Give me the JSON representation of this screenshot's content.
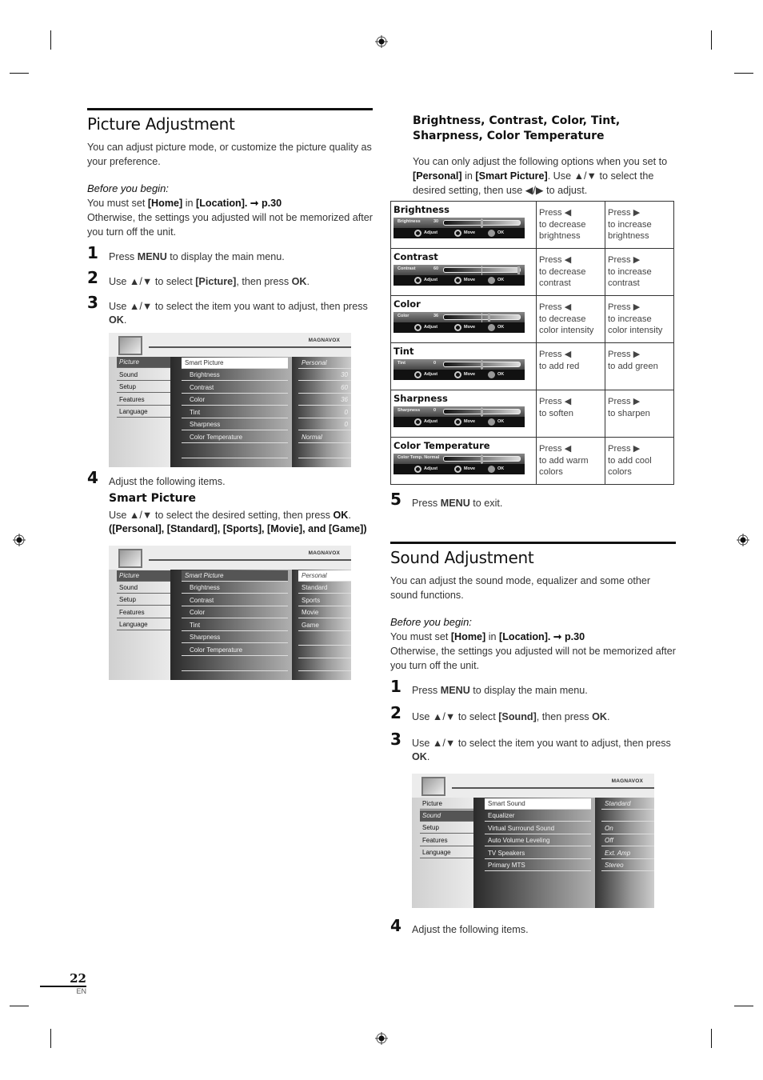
{
  "picture_adjustment": {
    "title": "Picture Adjustment",
    "intro": "You can adjust picture mode, or customize the picture quality as your preference.",
    "before_label": "Before you begin:",
    "before_line1_pre": "You must set ",
    "before_line1_home": "[Home]",
    "before_line1_in": " in ",
    "before_line1_loc": "[Location]",
    "before_line1_ref": ". ➞ p.30",
    "before_line2": "Otherwise, the settings you adjusted will not be memorized after you turn off the unit.",
    "steps": [
      {
        "num": "1",
        "pre": "Press ",
        "key": "MENU",
        "post": " to display the main menu."
      },
      {
        "num": "2",
        "pre": "Use ▲/▼ to select ",
        "key": "[Picture]",
        "post": ", then press ",
        "key2": "OK",
        "post2": "."
      },
      {
        "num": "3",
        "pre": "Use ▲/▼ to select the item you want to adjust, then press ",
        "key": "OK",
        "post": "."
      },
      {
        "num": "4",
        "text": "Adjust the following items."
      }
    ],
    "smart_picture": {
      "heading": "Smart Picture",
      "line1_pre": "Use ▲/▼ to select the desired setting, then press ",
      "line1_key": "OK",
      "line1_post": ".",
      "options_text": "([Personal], [Standard], [Sports], [Movie], and [Game])"
    }
  },
  "tv_menu_1": {
    "brand": "MAGNAVOX",
    "left_items": [
      "Picture",
      "Sound",
      "Setup",
      "Features",
      "Language"
    ],
    "selected_left": "Picture",
    "mid_items": [
      "Smart Picture",
      "Brightness",
      "Contrast",
      "Color",
      "Tint",
      "Sharpness",
      "Color Temperature"
    ],
    "right_values": [
      "Personal",
      "30",
      "60",
      "36",
      "0",
      "0",
      "Normal"
    ]
  },
  "tv_menu_2": {
    "brand": "MAGNAVOX",
    "left_items": [
      "Picture",
      "Sound",
      "Setup",
      "Features",
      "Language"
    ],
    "mid_items": [
      "Smart Picture",
      "Brightness",
      "Contrast",
      "Color",
      "Tint",
      "Sharpness",
      "Color Temperature"
    ],
    "right_options": [
      "Personal",
      "Standard",
      "Sports",
      "Movie",
      "Game"
    ],
    "selected_option": "Personal"
  },
  "adjust_section": {
    "heading": "Brightness, Contrast, Color, Tint, Sharpness, Color Temperature",
    "intro_pre": "You can only adjust the following options when you set to ",
    "intro_personal": "[Personal]",
    "intro_in": " in ",
    "intro_smart": "[Smart Picture]",
    "intro_post": ". Use ▲/▼ to select the desired setting, then use ◀/▶ to adjust.",
    "osd_keys": {
      "adjust": "Adjust",
      "move": "Move",
      "ok": "OK"
    },
    "rows": [
      {
        "name": "Brightness",
        "osd_label": "Brightness",
        "osd_value": "30",
        "level": 0.5,
        "left": "Press ◀\nto decrease brightness",
        "left1": "Press ◀",
        "left2": "to decrease brightness",
        "right1": "Press ▶",
        "right2": "to increase brightness"
      },
      {
        "name": "Contrast",
        "osd_label": "Contrast",
        "osd_value": "60",
        "level": 1.0,
        "left1": "Press ◀",
        "left2": "to decrease contrast",
        "right1": "Press ▶",
        "right2": "to increase contrast"
      },
      {
        "name": "Color",
        "osd_label": "Color",
        "osd_value": "36",
        "level": 0.6,
        "left1": "Press ◀",
        "left2": "to decrease color intensity",
        "right1": "Press ▶",
        "right2": "to increase color intensity"
      },
      {
        "name": "Tint",
        "osd_label": "Tint",
        "osd_value": "0",
        "level": 0.5,
        "left1": "Press ◀",
        "left2": "to add red",
        "right1": "Press ▶",
        "right2": "to add green"
      },
      {
        "name": "Sharpness",
        "osd_label": "Sharpness",
        "osd_value": "0",
        "level": 0.5,
        "left1": "Press ◀",
        "left2": "to soften",
        "right1": "Press ▶",
        "right2": "to sharpen"
      },
      {
        "name": "Color Temperature",
        "osd_label": "Color Temp. Normal",
        "osd_value": "",
        "level": 0.5,
        "left1": "Press ◀",
        "left2": "to add warm colors",
        "right1": "Press ▶",
        "right2": "to add cool colors"
      }
    ],
    "step5": {
      "num": "5",
      "pre": "Press ",
      "key": "MENU",
      "post": " to exit."
    }
  },
  "sound_adjustment": {
    "title": "Sound Adjustment",
    "intro": "You can adjust the sound mode, equalizer and some other sound functions.",
    "before_label": "Before you begin:",
    "before_line1_pre": "You must set ",
    "before_line1_home": "[Home]",
    "before_line1_in": " in ",
    "before_line1_loc": "[Location]",
    "before_line1_ref": ". ➞ p.30",
    "before_line2": "Otherwise, the settings you adjusted will not be memorized after you turn off the unit.",
    "steps": [
      {
        "num": "1",
        "pre": "Press ",
        "key": "MENU",
        "post": " to display the main menu."
      },
      {
        "num": "2",
        "pre": "Use ▲/▼ to select ",
        "key": "[Sound]",
        "post": ", then press ",
        "key2": "OK",
        "post2": "."
      },
      {
        "num": "3",
        "pre": "Use ▲/▼ to select the item you want to adjust, then press ",
        "key": "OK",
        "post": "."
      },
      {
        "num": "4",
        "text": "Adjust the following items."
      }
    ]
  },
  "tv_menu_3": {
    "brand": "MAGNAVOX",
    "left_items": [
      "Picture",
      "Sound",
      "Setup",
      "Features",
      "Language"
    ],
    "selected_left": "Sound",
    "mid_items": [
      "Smart Sound",
      "Equalizer",
      "Virtual Surround Sound",
      "Auto Volume Leveling",
      "TV Speakers",
      "Primary MTS"
    ],
    "right_values": [
      "Standard",
      "",
      "On",
      "Off",
      "Ext. Amp",
      "Stereo"
    ]
  },
  "footer": {
    "page_number": "22",
    "language": "EN"
  }
}
